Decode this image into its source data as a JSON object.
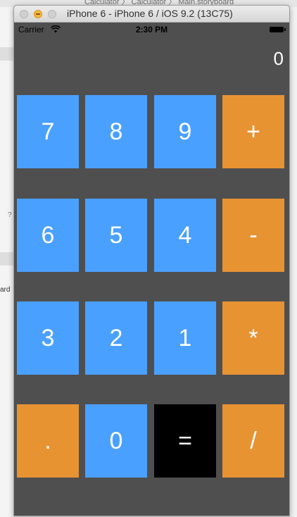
{
  "background": {
    "path_text": "Calculator  〉 Calculator  〉 Main.storyboard",
    "left_fragment_1": "?",
    "left_fragment_2": "ard"
  },
  "window": {
    "title": "iPhone 6 - iPhone 6 / iOS 9.2 (13C75)"
  },
  "status_bar": {
    "carrier": "Carrier",
    "time": "2:30 PM"
  },
  "calculator": {
    "display_value": "0",
    "keys": [
      {
        "label": "7",
        "color": "#4aa0ff"
      },
      {
        "label": "8",
        "color": "#4aa0ff"
      },
      {
        "label": "9",
        "color": "#4aa0ff"
      },
      {
        "label": "+",
        "color": "#e89332"
      },
      {
        "label": "6",
        "color": "#4aa0ff"
      },
      {
        "label": "5",
        "color": "#4aa0ff"
      },
      {
        "label": "4",
        "color": "#4aa0ff"
      },
      {
        "label": "-",
        "color": "#e89332"
      },
      {
        "label": "3",
        "color": "#4aa0ff"
      },
      {
        "label": "2",
        "color": "#4aa0ff"
      },
      {
        "label": "1",
        "color": "#4aa0ff"
      },
      {
        "label": "*",
        "color": "#e89332"
      },
      {
        "label": ".",
        "color": "#e89332"
      },
      {
        "label": "0",
        "color": "#4aa0ff"
      },
      {
        "label": "=",
        "color": "#000000"
      },
      {
        "label": "/",
        "color": "#e89332"
      }
    ]
  },
  "colors": {
    "number_key": "#4aa0ff",
    "operator_key": "#e89332",
    "equals_key": "#000000",
    "screen_background": "#4f4f4f"
  }
}
